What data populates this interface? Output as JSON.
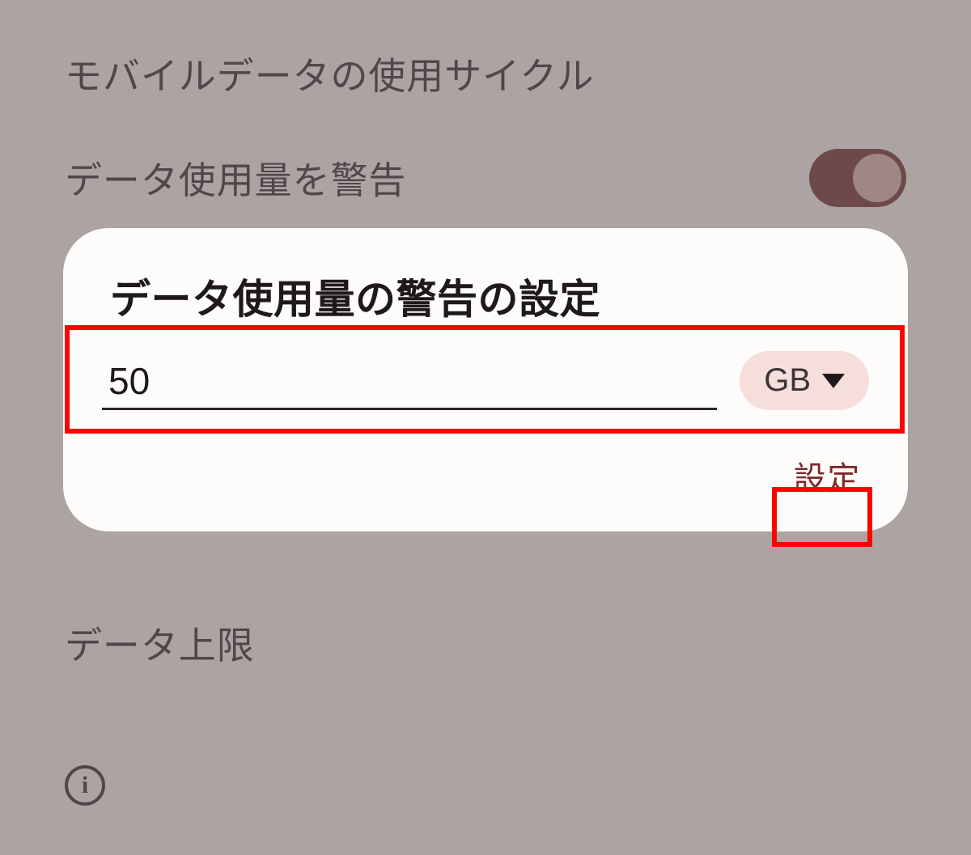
{
  "background": {
    "items": [
      {
        "label": "モバイルデータの使用サイクル",
        "toggle": false
      },
      {
        "label": "データ使用量を警告",
        "toggle": true
      },
      {
        "label": "データ上限",
        "toggle": false
      }
    ]
  },
  "dialog": {
    "title": "データ使用量の警告の設定",
    "value": "50",
    "unit": "GB",
    "confirm_label": "設定"
  }
}
